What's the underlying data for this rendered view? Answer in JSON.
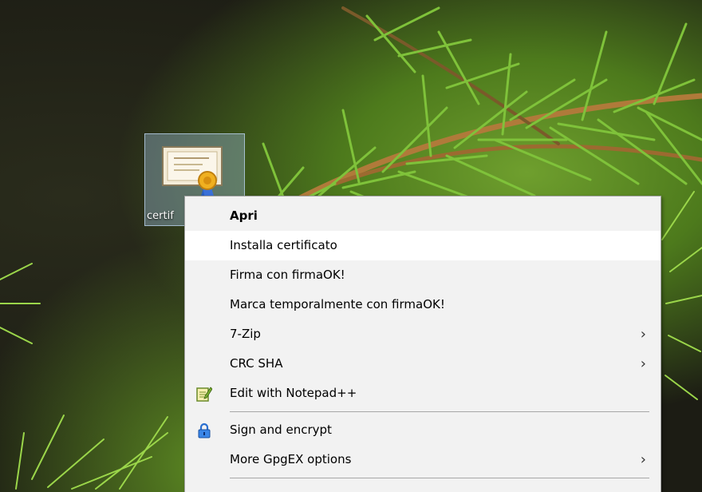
{
  "desktop": {
    "icon": {
      "label": "certif",
      "icon_name": "certificate-file-icon"
    }
  },
  "context_menu": {
    "items": [
      {
        "label": "Apri",
        "bold": true
      },
      {
        "label": "Installa certificato",
        "highlighted": true
      },
      {
        "label": "Firma con firmaOK!"
      },
      {
        "label": "Marca temporalmente con firmaOK!"
      },
      {
        "label": "7-Zip",
        "submenu": true,
        "arrow": "›"
      },
      {
        "label": "CRC SHA",
        "submenu": true,
        "arrow": "›"
      },
      {
        "label": "Edit with Notepad++",
        "icon": "notepad-plus-plus-icon"
      },
      {
        "label": "Sign and encrypt",
        "icon": "padlock-icon"
      },
      {
        "label": "More GpgEX options",
        "submenu": true,
        "arrow": "›"
      }
    ]
  },
  "colors": {
    "menu_background": "#f2f2f2",
    "menu_highlight": "#ffffff",
    "icon_selection": "#96b4d2"
  }
}
